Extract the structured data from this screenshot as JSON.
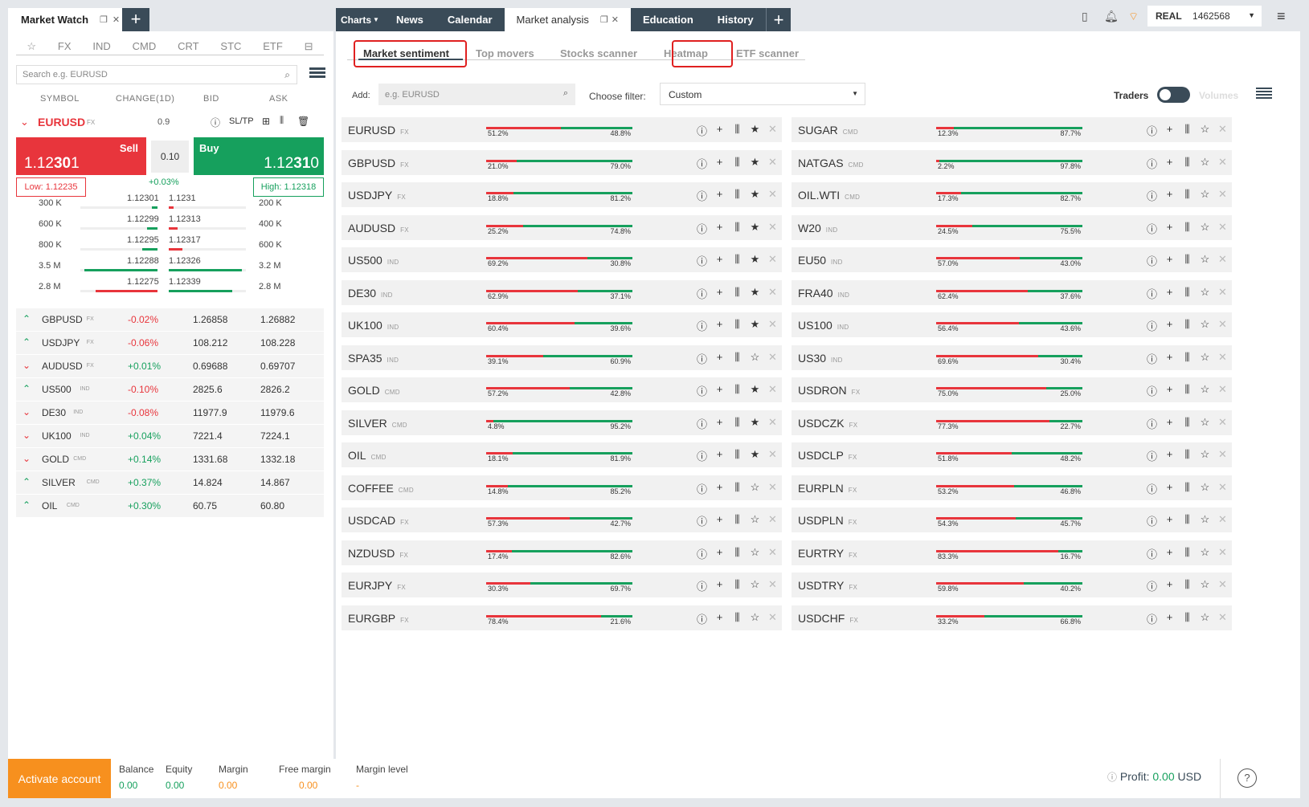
{
  "market_watch": {
    "title": "Market Watch",
    "cat_tabs": [
      "☆",
      "FX",
      "IND",
      "CMD",
      "CRT",
      "STC",
      "ETF"
    ],
    "search_placeholder": "Search e.g. EURUSD",
    "columns": [
      "SYMBOL",
      "CHANGE(1D)",
      "BID",
      "ASK"
    ],
    "selected": {
      "symbol": "EURUSD",
      "type": "FX",
      "spread": "0.9",
      "sltp": "SL/TP",
      "sell_label": "Sell",
      "sell_price_small": "1.12",
      "sell_price_big": "30",
      "sell_price_tail": "1",
      "lot": "0.10",
      "buy_label": "Buy",
      "buy_price_small": "1.12",
      "buy_price_big": "31",
      "buy_price_tail": "0",
      "low": "Low: 1.12235",
      "high": "High: 1.12318",
      "change": "+0.03%"
    },
    "depth": [
      {
        "bid_vol": "300 K",
        "bid": "1.12301",
        "ask": "1.1231",
        "ask_vol": "200 K",
        "bid_fill": 0.07,
        "ask_fill": 0.06
      },
      {
        "bid_vol": "600 K",
        "bid": "1.12299",
        "ask": "1.12313",
        "ask_vol": "400 K",
        "bid_fill": 0.14,
        "ask_fill": 0.11
      },
      {
        "bid_vol": "800 K",
        "bid": "1.12295",
        "ask": "1.12317",
        "ask_vol": "600 K",
        "bid_fill": 0.2,
        "ask_fill": 0.18
      },
      {
        "bid_vol": "3.5 M",
        "bid": "1.12288",
        "ask": "1.12326",
        "ask_vol": "3.2 M",
        "bid_fill": 0.95,
        "ask_fill": 0.95
      },
      {
        "bid_vol": "2.8 M",
        "bid": "1.12275",
        "ask": "1.12339",
        "ask_vol": "2.8 M",
        "bid_fill": 0.8,
        "ask_fill": 0.82
      }
    ],
    "rows": [
      {
        "symbol": "GBPUSD",
        "type": "FX",
        "change": "-0.02%",
        "bid": "1.26858",
        "ask": "1.26882"
      },
      {
        "symbol": "USDJPY",
        "type": "FX",
        "change": "-0.06%",
        "bid": "108.212",
        "ask": "108.228"
      },
      {
        "symbol": "AUDUSD",
        "type": "FX",
        "change": "+0.01%",
        "bid": "0.69688",
        "ask": "0.69707"
      },
      {
        "symbol": "US500",
        "type": "IND",
        "change": "-0.10%",
        "bid": "2825.6",
        "ask": "2826.2"
      },
      {
        "symbol": "DE30",
        "type": "IND",
        "change": "-0.08%",
        "bid": "11977.9",
        "ask": "11979.6"
      },
      {
        "symbol": "UK100",
        "type": "IND",
        "change": "+0.04%",
        "bid": "7221.4",
        "ask": "7224.1"
      },
      {
        "symbol": "GOLD",
        "type": "CMD",
        "change": "+0.14%",
        "bid": "1331.68",
        "ask": "1332.18"
      },
      {
        "symbol": "SILVER",
        "type": "CMD",
        "change": "+0.37%",
        "bid": "14.824",
        "ask": "14.867"
      },
      {
        "symbol": "OIL",
        "type": "CMD",
        "change": "+0.30%",
        "bid": "60.75",
        "ask": "60.80"
      }
    ]
  },
  "top_tabs": [
    "Charts",
    "News",
    "Calendar",
    "Market analysis",
    "Education",
    "History"
  ],
  "account": {
    "mode": "REAL",
    "number": "1462568"
  },
  "analysis": {
    "subtabs": [
      "Market sentiment",
      "Top movers",
      "Stocks scanner",
      "Heatmap",
      "ETF scanner"
    ],
    "add_label": "Add:",
    "add_placeholder": "e.g. EURUSD",
    "filter_label": "Choose filter:",
    "filter_value": "Custom",
    "traders_label": "Traders",
    "volumes_label": "Volumes",
    "left": [
      {
        "symbol": "EURUSD",
        "type": "FX",
        "sell": "51.2%",
        "buy": "48.8%",
        "s": 0.512,
        "fav": true
      },
      {
        "symbol": "GBPUSD",
        "type": "FX",
        "sell": "21.0%",
        "buy": "79.0%",
        "s": 0.21,
        "fav": true
      },
      {
        "symbol": "USDJPY",
        "type": "FX",
        "sell": "18.8%",
        "buy": "81.2%",
        "s": 0.188,
        "fav": true
      },
      {
        "symbol": "AUDUSD",
        "type": "FX",
        "sell": "25.2%",
        "buy": "74.8%",
        "s": 0.252,
        "fav": true
      },
      {
        "symbol": "US500",
        "type": "IND",
        "sell": "69.2%",
        "buy": "30.8%",
        "s": 0.692,
        "fav": true
      },
      {
        "symbol": "DE30",
        "type": "IND",
        "sell": "62.9%",
        "buy": "37.1%",
        "s": 0.629,
        "fav": true
      },
      {
        "symbol": "UK100",
        "type": "IND",
        "sell": "60.4%",
        "buy": "39.6%",
        "s": 0.604,
        "fav": true
      },
      {
        "symbol": "SPA35",
        "type": "IND",
        "sell": "39.1%",
        "buy": "60.9%",
        "s": 0.391,
        "fav": false
      },
      {
        "symbol": "GOLD",
        "type": "CMD",
        "sell": "57.2%",
        "buy": "42.8%",
        "s": 0.572,
        "fav": true
      },
      {
        "symbol": "SILVER",
        "type": "CMD",
        "sell": "4.8%",
        "buy": "95.2%",
        "s": 0.048,
        "fav": true
      },
      {
        "symbol": "OIL",
        "type": "CMD",
        "sell": "18.1%",
        "buy": "81.9%",
        "s": 0.181,
        "fav": true
      },
      {
        "symbol": "COFFEE",
        "type": "CMD",
        "sell": "14.8%",
        "buy": "85.2%",
        "s": 0.148,
        "fav": false
      },
      {
        "symbol": "USDCAD",
        "type": "FX",
        "sell": "57.3%",
        "buy": "42.7%",
        "s": 0.573,
        "fav": false
      },
      {
        "symbol": "NZDUSD",
        "type": "FX",
        "sell": "17.4%",
        "buy": "82.6%",
        "s": 0.174,
        "fav": false
      },
      {
        "symbol": "EURJPY",
        "type": "FX",
        "sell": "30.3%",
        "buy": "69.7%",
        "s": 0.303,
        "fav": false
      },
      {
        "symbol": "EURGBP",
        "type": "FX",
        "sell": "78.4%",
        "buy": "21.6%",
        "s": 0.784,
        "fav": false
      }
    ],
    "right": [
      {
        "symbol": "SUGAR",
        "type": "CMD",
        "sell": "12.3%",
        "buy": "87.7%",
        "s": 0.123,
        "fav": false
      },
      {
        "symbol": "NATGAS",
        "type": "CMD",
        "sell": "2.2%",
        "buy": "97.8%",
        "s": 0.022,
        "fav": false
      },
      {
        "symbol": "OIL.WTI",
        "type": "CMD",
        "sell": "17.3%",
        "buy": "82.7%",
        "s": 0.173,
        "fav": false
      },
      {
        "symbol": "W20",
        "type": "IND",
        "sell": "24.5%",
        "buy": "75.5%",
        "s": 0.245,
        "fav": false
      },
      {
        "symbol": "EU50",
        "type": "IND",
        "sell": "57.0%",
        "buy": "43.0%",
        "s": 0.57,
        "fav": false
      },
      {
        "symbol": "FRA40",
        "type": "IND",
        "sell": "62.4%",
        "buy": "37.6%",
        "s": 0.624,
        "fav": false
      },
      {
        "symbol": "US100",
        "type": "IND",
        "sell": "56.4%",
        "buy": "43.6%",
        "s": 0.564,
        "fav": false
      },
      {
        "symbol": "US30",
        "type": "IND",
        "sell": "69.6%",
        "buy": "30.4%",
        "s": 0.696,
        "fav": false
      },
      {
        "symbol": "USDRON",
        "type": "FX",
        "sell": "75.0%",
        "buy": "25.0%",
        "s": 0.75,
        "fav": false
      },
      {
        "symbol": "USDCZK",
        "type": "FX",
        "sell": "77.3%",
        "buy": "22.7%",
        "s": 0.773,
        "fav": false
      },
      {
        "symbol": "USDCLP",
        "type": "FX",
        "sell": "51.8%",
        "buy": "48.2%",
        "s": 0.518,
        "fav": false
      },
      {
        "symbol": "EURPLN",
        "type": "FX",
        "sell": "53.2%",
        "buy": "46.8%",
        "s": 0.532,
        "fav": false
      },
      {
        "symbol": "USDPLN",
        "type": "FX",
        "sell": "54.3%",
        "buy": "45.7%",
        "s": 0.543,
        "fav": false
      },
      {
        "symbol": "EURTRY",
        "type": "FX",
        "sell": "83.3%",
        "buy": "16.7%",
        "s": 0.833,
        "fav": false
      },
      {
        "symbol": "USDTRY",
        "type": "FX",
        "sell": "59.8%",
        "buy": "40.2%",
        "s": 0.598,
        "fav": false
      },
      {
        "symbol": "USDCHF",
        "type": "FX",
        "sell": "33.2%",
        "buy": "66.8%",
        "s": 0.332,
        "fav": false
      }
    ]
  },
  "footer": {
    "activate": "Activate account",
    "items": [
      {
        "label": "Balance",
        "value": "0.00"
      },
      {
        "label": "Equity",
        "value": "0.00"
      },
      {
        "label": "Margin",
        "value": "0.00"
      },
      {
        "label": "Free margin",
        "value": "0.00"
      },
      {
        "label": "Margin level",
        "value": "-"
      }
    ],
    "profit_label": "Profit:",
    "profit_value": "0.00",
    "profit_currency": "USD"
  },
  "colors": {
    "red": "#e8353c",
    "green": "#16a05d",
    "orange": "#f7901e",
    "dark": "#3a4b58"
  }
}
